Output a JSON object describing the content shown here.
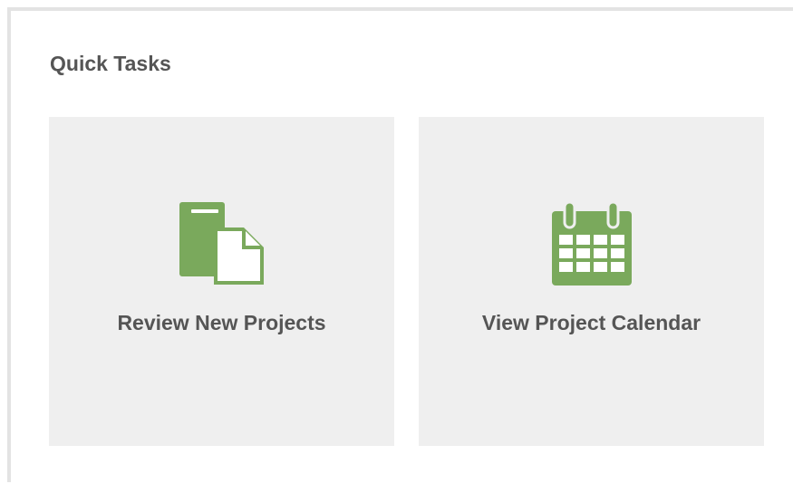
{
  "quick_tasks": {
    "title": "Quick Tasks",
    "accent_color": "#7aa95c",
    "tiles": [
      {
        "label": "Review New Projects",
        "icon": "documents-icon"
      },
      {
        "label": "View Project Calendar",
        "icon": "calendar-icon"
      }
    ]
  }
}
